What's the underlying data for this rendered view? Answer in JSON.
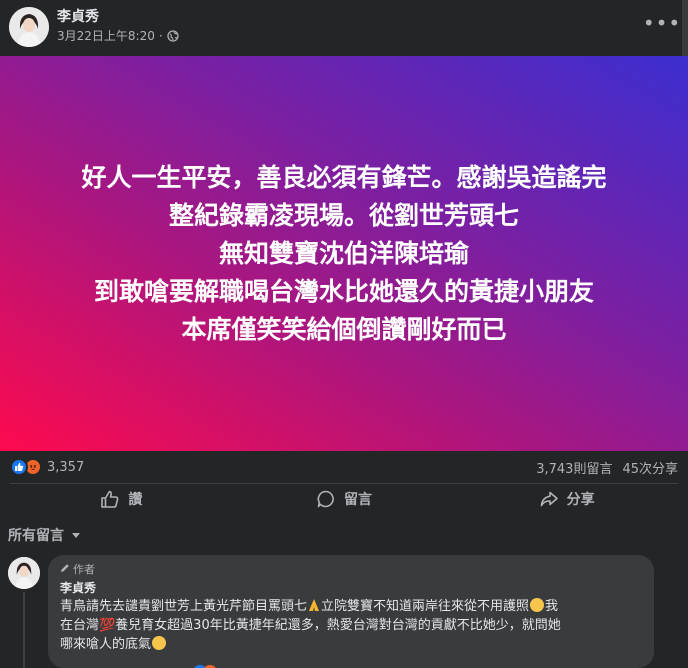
{
  "post": {
    "author": "李貞秀",
    "timestamp": "3月22日上午8:20",
    "privacy_separator": "·",
    "more_label": "•••",
    "image_text": [
      "好人一生平安，善良必須有鋒芒。感謝吳造謠完",
      "整紀錄霸凌現場。從劉世芳頭七",
      "無知雙寶沈伯洋陳培瑜",
      "到敢嗆要解職喝台灣水比她還久的黃捷小朋友",
      "本席僅笑笑給個倒讚剛好而已"
    ],
    "image_gradient": [
      "#fe0a4e",
      "#7e1fa0",
      "#3c2ed0"
    ]
  },
  "stats": {
    "reaction_icons": [
      "like-icon",
      "angry-icon"
    ],
    "reaction_count": "3,357",
    "comments": "3,743則留言",
    "shares": "45次分享"
  },
  "actions": {
    "like": "讚",
    "comment": "留言",
    "share": "分享"
  },
  "comments_section": {
    "filter_label": "所有留言"
  },
  "comment": {
    "badge": "作者",
    "author": "李貞秀",
    "line1_a": "青鳥請先去譴責劉世芳上黃光芹節目罵頭七",
    "line1_b": "立院雙寶不知道兩岸往來從不用護照",
    "line1_c": "我",
    "line2": "在台灣💯養兒育女超過30年比黃捷年紀還多，熱愛台灣對台灣的貢獻不比她少，就問她",
    "line3": "哪來嗆人的底氣"
  },
  "colors": {
    "background": "#242526",
    "bubble": "#3a3b3c",
    "secondary_text": "#b0b3b8",
    "primary_text": "#e4e6eb",
    "like_blue": "#1877f2",
    "angry_orange": "#f0642a"
  }
}
